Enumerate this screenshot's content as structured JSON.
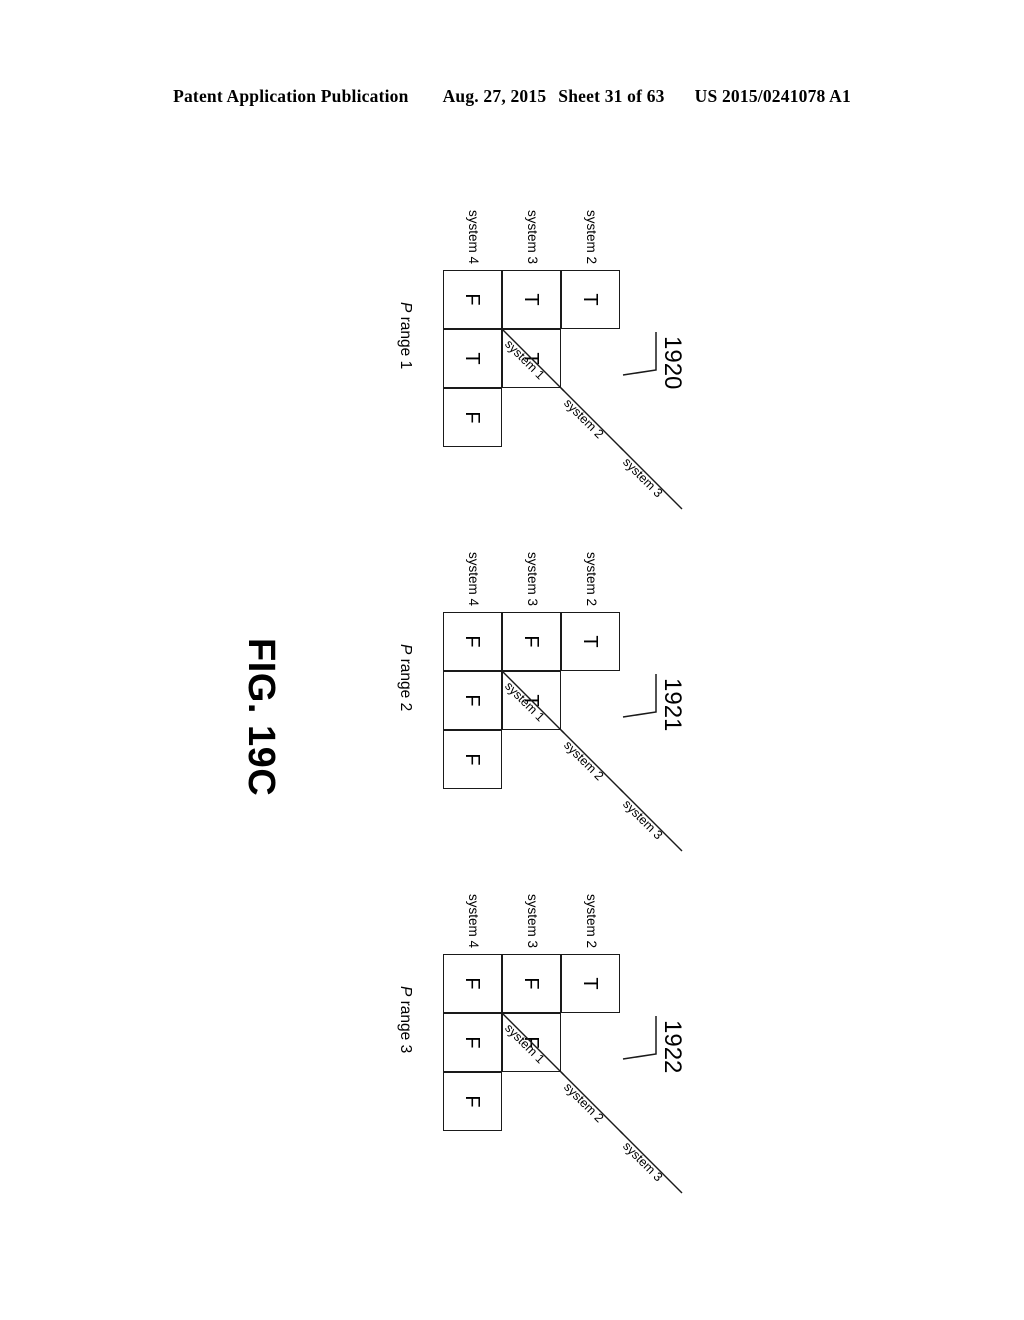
{
  "header": {
    "publication": "Patent Application Publication",
    "date": "Aug. 27, 2015",
    "sheet": "Sheet 31 of 63",
    "patent_number": "US 2015/0241078 A1"
  },
  "figure": {
    "caption": "FIG. 19C",
    "row_labels": [
      "system 2",
      "system 3",
      "system 4"
    ],
    "column_labels": [
      "system 1",
      "system 2",
      "system 3"
    ],
    "blocks": [
      {
        "ref": "1920",
        "prange_prefix": "P",
        "prange_text": " range 1",
        "rows": [
          {
            "label": "system 2",
            "cells": [
              "T"
            ]
          },
          {
            "label": "system 3",
            "cells": [
              "T",
              "T"
            ]
          },
          {
            "label": "system 4",
            "cells": [
              "F",
              "T",
              "F"
            ]
          }
        ]
      },
      {
        "ref": "1921",
        "prange_prefix": "P",
        "prange_text": " range 2",
        "rows": [
          {
            "label": "system 2",
            "cells": [
              "T"
            ]
          },
          {
            "label": "system 3",
            "cells": [
              "F",
              "T"
            ]
          },
          {
            "label": "system 4",
            "cells": [
              "F",
              "F",
              "F"
            ]
          }
        ]
      },
      {
        "ref": "1922",
        "prange_prefix": "P",
        "prange_text": " range 3",
        "rows": [
          {
            "label": "system 2",
            "cells": [
              "T"
            ]
          },
          {
            "label": "system 3",
            "cells": [
              "F",
              "F"
            ]
          },
          {
            "label": "system 4",
            "cells": [
              "F",
              "F",
              "F"
            ]
          }
        ]
      }
    ]
  },
  "colors": {
    "ink": "#1a1a1a",
    "page": "#ffffff"
  }
}
